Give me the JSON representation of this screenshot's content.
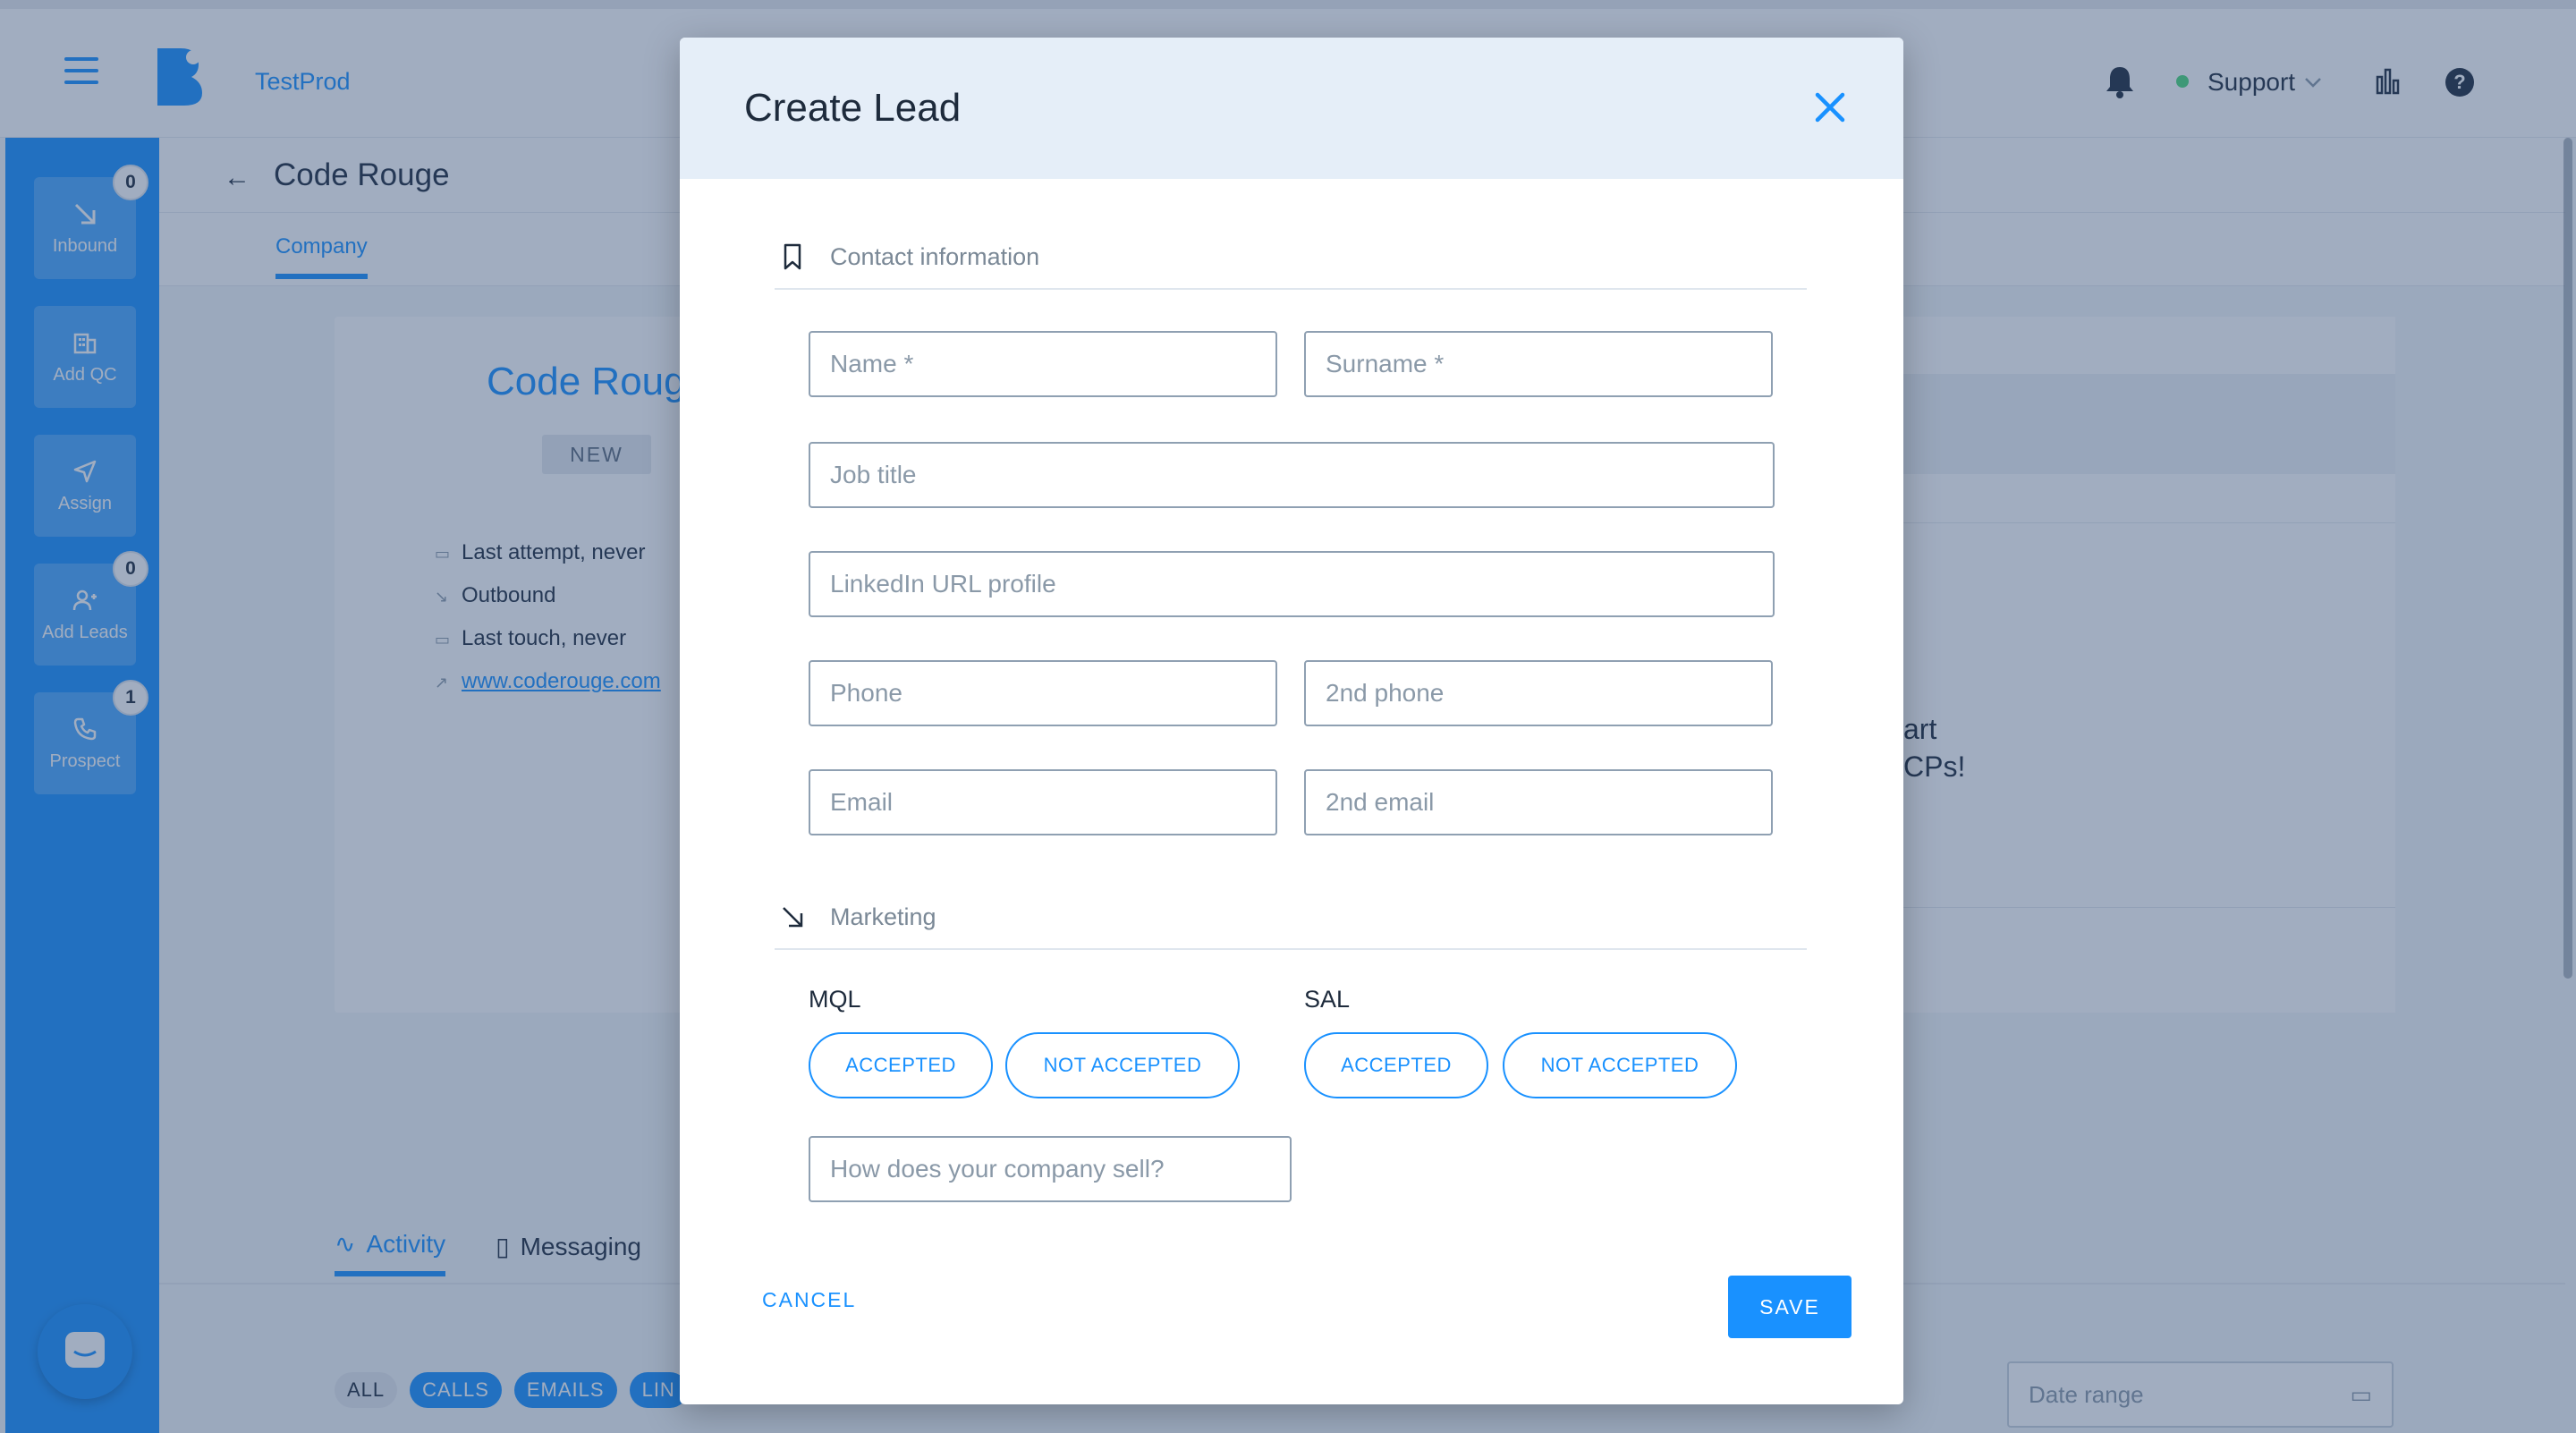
{
  "app": {
    "name": "TestProd",
    "support_label": "Support"
  },
  "sidebar": {
    "items": [
      {
        "label": "Inbound",
        "badge": "0"
      },
      {
        "label": "Add QC"
      },
      {
        "label": "Assign"
      },
      {
        "label": "Add Leads",
        "badge": "0"
      },
      {
        "label": "Prospect",
        "badge": "1"
      }
    ]
  },
  "page": {
    "title": "Code Rouge",
    "tab": "Company",
    "company_name": "Code Roug",
    "status": "NEW",
    "meta": {
      "last_attempt": "Last attempt, never",
      "outbound": "Outbound",
      "last_touch": "Last touch, never",
      "website": "www.coderouge.com"
    },
    "right_fragment_1": "art",
    "right_fragment_2": "CPs!",
    "activity_tab": "Activity",
    "messaging_tab": "Messaging",
    "filters": [
      "ALL",
      "CALLS",
      "EMAILS",
      "LIN"
    ],
    "date_range_placeholder": "Date range"
  },
  "modal": {
    "title": "Create Lead",
    "contact_section": "Contact information",
    "marketing_section": "Marketing",
    "fields": {
      "name": "Name *",
      "surname": "Surname *",
      "job_title": "Job title",
      "linkedin": "LinkedIn URL profile",
      "phone": "Phone",
      "phone2": "2nd phone",
      "email": "Email",
      "email2": "2nd email",
      "sell": "How does your company sell?"
    },
    "mql": {
      "label": "MQL",
      "accepted": "ACCEPTED",
      "not_accepted": "NOT ACCEPTED"
    },
    "sal": {
      "label": "SAL",
      "accepted": "ACCEPTED",
      "not_accepted": "NOT ACCEPTED"
    },
    "cancel": "CANCEL",
    "save": "SAVE"
  },
  "colors": {
    "primary": "#1991ff",
    "sidebar": "#1991ff",
    "overlay": "#2e4a73",
    "modal_header": "#e5eef8",
    "status_online": "#4cd97b"
  }
}
